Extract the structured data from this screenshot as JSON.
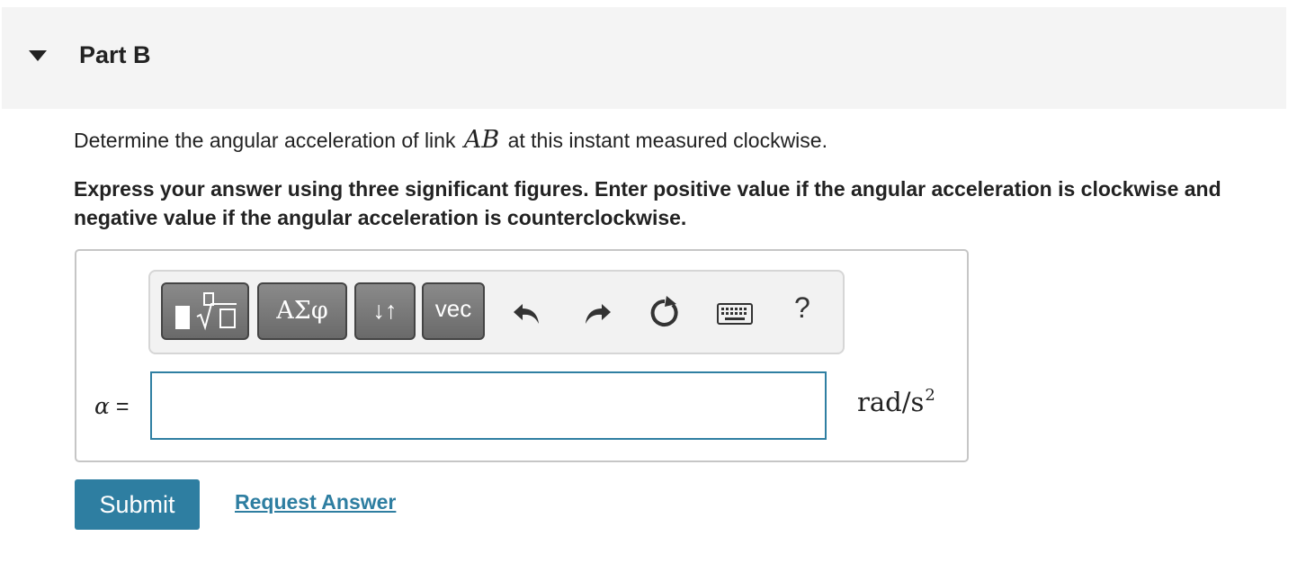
{
  "part": {
    "title": "Part B",
    "toggle_icon": "triangle-down-icon"
  },
  "question": {
    "prefix": "Determine the angular acceleration of link ",
    "math": "AB",
    "suffix": " at this instant measured clockwise."
  },
  "instructions": "Express your answer using three significant figures. Enter positive value if the angular acceleration is clockwise and negative value if the angular acceleration is counterclockwise.",
  "toolbar": {
    "templates_icon": "templates-icon",
    "greek_label": "ΑΣφ",
    "arrows_label": "↓↑",
    "vec_label": "vec",
    "undo_icon": "undo-icon",
    "redo_icon": "redo-icon",
    "reset_icon": "reset-icon",
    "keyboard_icon": "keyboard-icon",
    "help_label": "?"
  },
  "answer": {
    "variable": "α",
    "equals": " =",
    "value": "",
    "placeholder": "",
    "unit_base": "rad/s",
    "unit_exp": "2"
  },
  "actions": {
    "submit_label": "Submit",
    "request_label": "Request Answer"
  },
  "colors": {
    "accent": "#2e7ea1",
    "header_bg": "#f4f4f4",
    "tool_button": "#7a7a7a"
  }
}
